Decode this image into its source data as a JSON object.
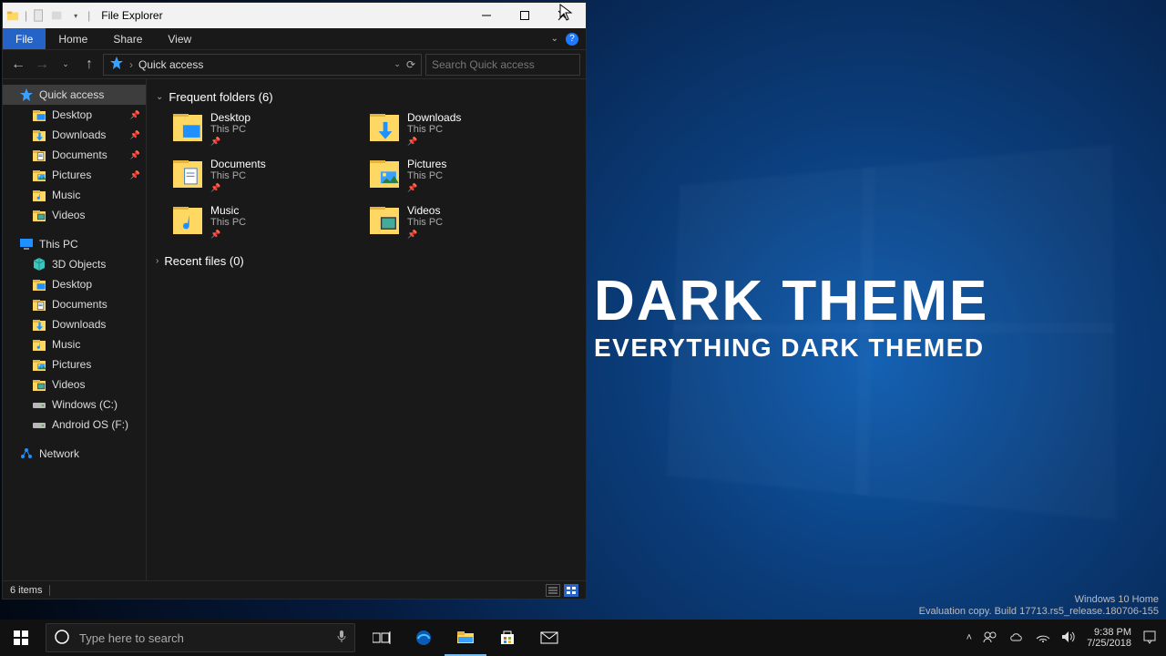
{
  "window": {
    "title": "File Explorer",
    "ribbon": {
      "file": "File",
      "tabs": [
        "Home",
        "Share",
        "View"
      ]
    },
    "address": {
      "location": "Quick access",
      "search_placeholder": "Search Quick access"
    },
    "status": {
      "count": "6 items"
    }
  },
  "sidebar": {
    "quick_access": {
      "label": "Quick access",
      "pinned": [
        {
          "label": "Desktop",
          "icon": "desktop"
        },
        {
          "label": "Downloads",
          "icon": "downloads"
        },
        {
          "label": "Documents",
          "icon": "documents"
        },
        {
          "label": "Pictures",
          "icon": "pictures"
        },
        {
          "label": "Music",
          "icon": "music"
        },
        {
          "label": "Videos",
          "icon": "videos"
        }
      ]
    },
    "this_pc": {
      "label": "This PC",
      "children": [
        {
          "label": "3D Objects",
          "icon": "3d"
        },
        {
          "label": "Desktop",
          "icon": "desktop"
        },
        {
          "label": "Documents",
          "icon": "documents"
        },
        {
          "label": "Downloads",
          "icon": "downloads"
        },
        {
          "label": "Music",
          "icon": "music"
        },
        {
          "label": "Pictures",
          "icon": "pictures"
        },
        {
          "label": "Videos",
          "icon": "videos"
        },
        {
          "label": "Windows (C:)",
          "icon": "drive"
        },
        {
          "label": "Android OS (F:)",
          "icon": "drive"
        }
      ]
    },
    "network": {
      "label": "Network"
    }
  },
  "content": {
    "frequent_header": "Frequent folders (6)",
    "recent_header": "Recent files (0)",
    "sub": "This PC",
    "items": [
      {
        "name": "Desktop",
        "icon": "desktop"
      },
      {
        "name": "Downloads",
        "icon": "downloads"
      },
      {
        "name": "Documents",
        "icon": "documents"
      },
      {
        "name": "Pictures",
        "icon": "pictures"
      },
      {
        "name": "Music",
        "icon": "music"
      },
      {
        "name": "Videos",
        "icon": "videos"
      }
    ]
  },
  "overlay": {
    "title": "DARK THEME",
    "subtitle": "EVERYTHING DARK THEMED"
  },
  "desktop_info": {
    "l1": "Windows 10 Home",
    "l2": "Evaluation copy. Build 17713.rs5_release.180706-155"
  },
  "taskbar": {
    "search_placeholder": "Type here to search",
    "clock": {
      "time": "9:38 PM",
      "date": "7/25/2018"
    }
  }
}
